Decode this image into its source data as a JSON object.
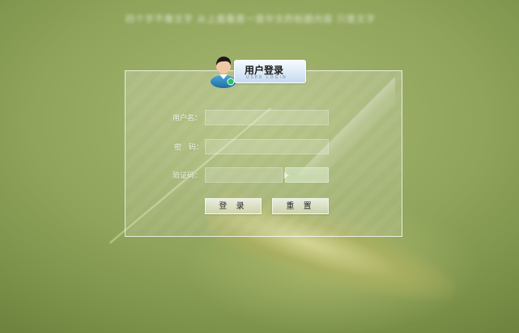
{
  "page": {
    "banner_text": "四个字不像文字 从上面看是一首中文的标题内容 只是文字"
  },
  "login": {
    "title_cn": "用户登录",
    "title_en": "USER LOGIN",
    "username_label": "用户名：",
    "password_label": "密　码：",
    "captcha_label": "验证码：",
    "username_value": "",
    "password_value": "",
    "captcha_value": "",
    "login_button": "登 录",
    "reset_button": "重 置"
  },
  "colors": {
    "accent": "#c7dbef",
    "panel_border": "#ffffff"
  },
  "icons": {
    "avatar": "user-avatar-icon"
  }
}
